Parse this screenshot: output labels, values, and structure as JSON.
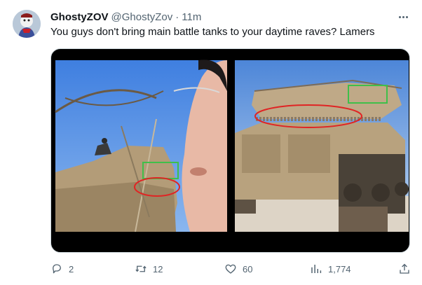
{
  "tweet": {
    "author_name": "GhostyZOV",
    "author_handle": "@GhostyZov",
    "separator": "·",
    "time": "11m",
    "text": "You guys don't bring main battle tanks to your daytime raves? Lamers"
  },
  "icons": {
    "more": "more-horizontal-icon",
    "reply": "reply-icon",
    "retweet": "retweet-icon",
    "like": "heart-icon",
    "views": "views-icon",
    "share": "share-icon"
  },
  "actions": {
    "replies": "2",
    "retweets": "12",
    "likes": "60",
    "views": "1,774"
  },
  "annotation_colors": {
    "box": "#3fbf4a",
    "ellipse": "#e02424"
  },
  "colors": {
    "text_primary": "#0f1419",
    "text_secondary": "#536471",
    "media_background": "#000000"
  }
}
